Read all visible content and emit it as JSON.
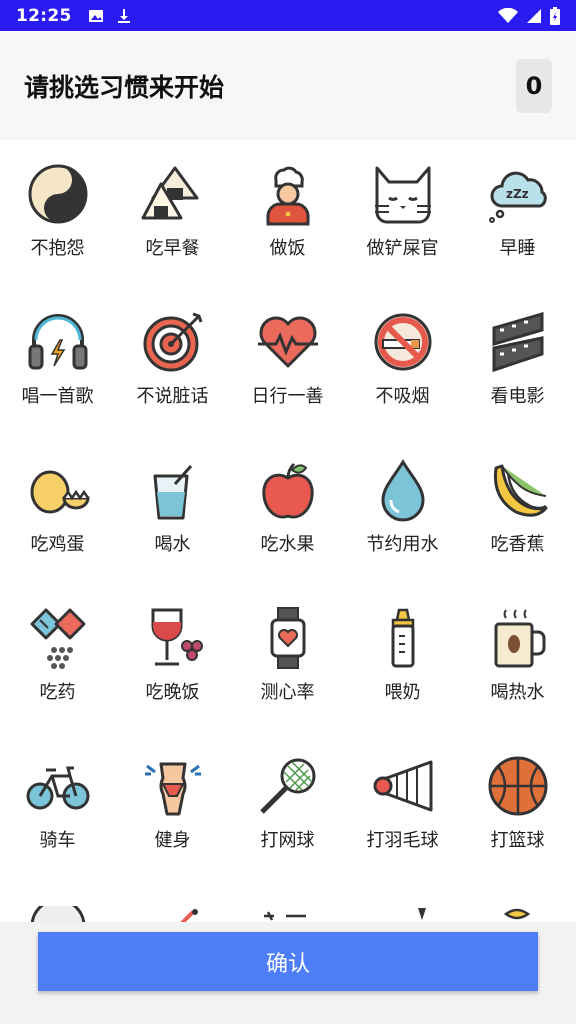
{
  "status": {
    "time": "12:25",
    "icons": [
      "image-icon",
      "download-icon",
      "wifi-icon",
      "signal-icon",
      "battery-icon"
    ]
  },
  "header": {
    "title": "请挑选习惯来开始",
    "count": "0"
  },
  "habits": [
    [
      "不抱怨",
      "吃早餐",
      "做饭",
      "做铲屎官",
      "早睡"
    ],
    [
      "唱一首歌",
      "不说脏话",
      "日行一善",
      "不吸烟",
      "看电影"
    ],
    [
      "吃鸡蛋",
      "喝水",
      "吃水果",
      "节约用水",
      "吃香蕉"
    ],
    [
      "吃药",
      "吃晚饭",
      "测心率",
      "喂奶",
      "喝热水"
    ],
    [
      "骑车",
      "健身",
      "打网球",
      "打羽毛球",
      "打篮球"
    ]
  ],
  "footer": {
    "confirm_label": "确认"
  },
  "colors": {
    "statusbar": "#2a1cf0",
    "button": "#4d7ef7",
    "header_bg": "#f7f7f7"
  }
}
